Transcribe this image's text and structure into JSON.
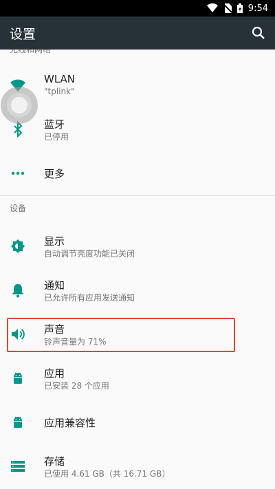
{
  "status_bar": {
    "time": "9:54"
  },
  "app_bar": {
    "title": "设置"
  },
  "clipped_section_header": "无线和网络",
  "items": [
    {
      "id": "wlan",
      "title": "WLAN",
      "subtitle": "\"tplink\"",
      "icon": "wifi-icon"
    },
    {
      "id": "bluetooth",
      "title": "蓝牙",
      "subtitle": "已停用",
      "icon": "bluetooth-icon"
    },
    {
      "id": "more",
      "title": "更多",
      "subtitle": "",
      "icon": "more-icon"
    }
  ],
  "device_section_header": "设备",
  "device_items": [
    {
      "id": "display",
      "title": "显示",
      "subtitle": "自动调节亮度功能已关闭",
      "icon": "brightness-icon"
    },
    {
      "id": "notifications",
      "title": "通知",
      "subtitle": "已允许所有应用发送通知",
      "icon": "bell-icon"
    },
    {
      "id": "sound",
      "title": "声音",
      "subtitle": "铃声音量为 71%",
      "icon": "volume-icon"
    },
    {
      "id": "apps",
      "title": "应用",
      "subtitle": "已安装 28 个应用",
      "icon": "android-icon"
    },
    {
      "id": "app-compat",
      "title": "应用兼容性",
      "subtitle": "",
      "icon": "android-icon"
    },
    {
      "id": "storage",
      "title": "存储",
      "subtitle": "已使用 4.61 GB（共 16.71 GB）",
      "icon": "storage-icon"
    }
  ],
  "colors": {
    "accent": "#009688",
    "app_bar": "#263238",
    "highlight_box": "#e8442f"
  }
}
